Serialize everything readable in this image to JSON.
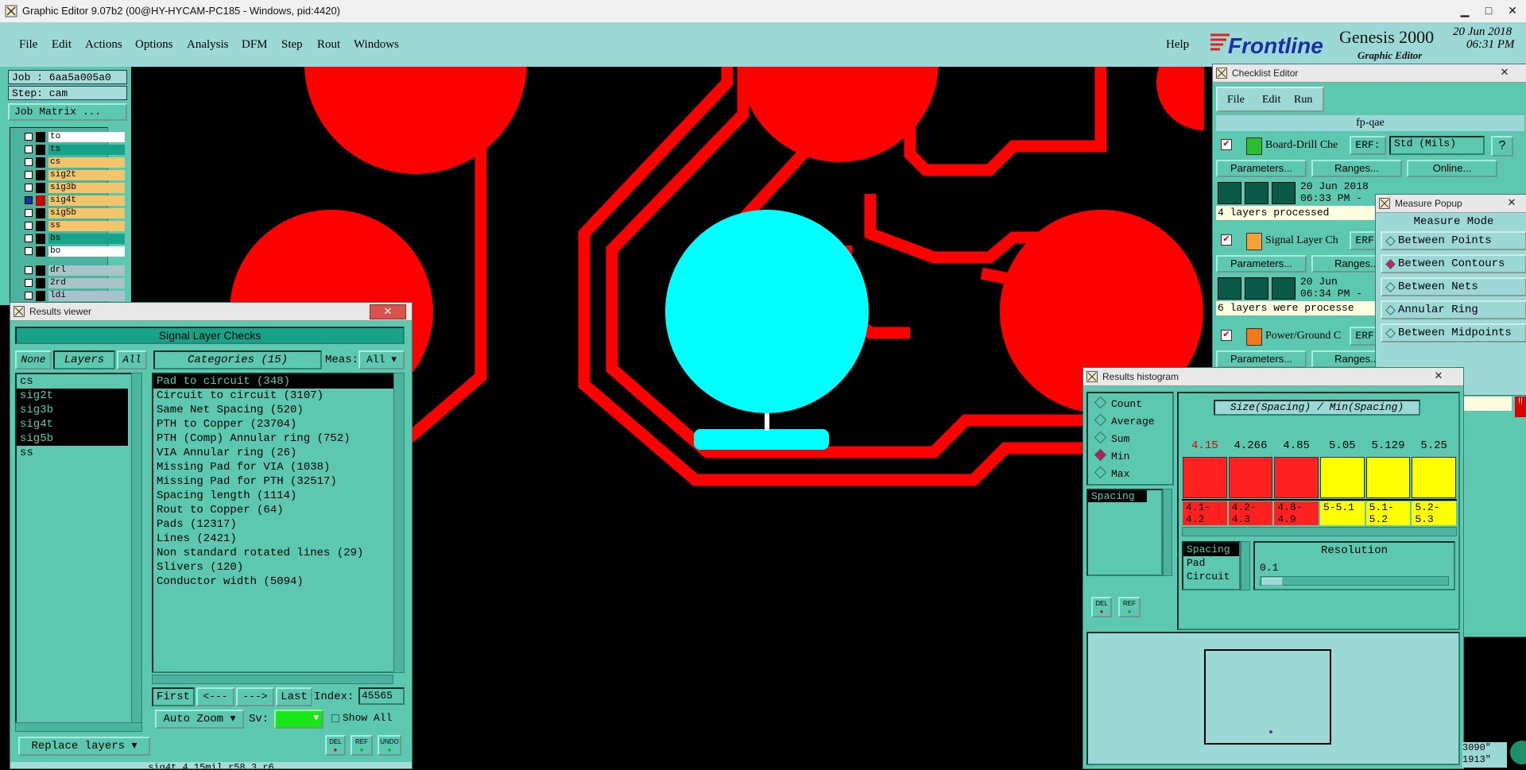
{
  "window": {
    "title": "Graphic Editor 9.07b2 (00@HY-HYCAM-PC185 - Windows, pid:4420)",
    "minimize": "▁",
    "maximize": "□",
    "close": "✕"
  },
  "menubar": {
    "items": [
      "File",
      "Edit",
      "Actions",
      "Options",
      "Analysis",
      "DFM",
      "Step",
      "Rout",
      "Windows"
    ],
    "help": "Help"
  },
  "brand": {
    "logo": "Frontline",
    "product": "Genesis 2000",
    "subtitle": "Graphic Editor",
    "date": "20 Jun 2018",
    "time": "06:31 PM"
  },
  "job": {
    "job_label": "Job : 6aa5a005a0",
    "step_label": "Step: cam",
    "matrix_button": "Job Matrix ..."
  },
  "layers": [
    {
      "name": "to",
      "color": "#ffffff"
    },
    {
      "name": "ts",
      "color": "#17a389"
    },
    {
      "name": "cs",
      "color": "#f4c46a"
    },
    {
      "name": "sig2t",
      "color": "#f4c46a"
    },
    {
      "name": "sig3b",
      "color": "#f4c46a"
    },
    {
      "name": "sig4t",
      "color": "#f4c46a",
      "active": true
    },
    {
      "name": "sig5b",
      "color": "#f4c46a"
    },
    {
      "name": "ss",
      "color": "#f4c46a"
    },
    {
      "name": "bs",
      "color": "#17a389"
    },
    {
      "name": "bo",
      "color": "#ffffff"
    },
    {
      "name": "drl",
      "color": "#a8c4c8"
    },
    {
      "name": "2rd",
      "color": "#a8c4c8"
    },
    {
      "name": "ldi",
      "color": "#a8c4c8"
    }
  ],
  "results_viewer": {
    "title": "Results viewer",
    "close": "✕",
    "header": "Signal Layer Checks",
    "none_btn": "None",
    "layers_btn": "Layers",
    "all_btn": "All",
    "categories_btn": "Categories (15)",
    "meas_label": "Meas:",
    "meas_value": "All",
    "layer_list": [
      "cs",
      "sig2t",
      "sig3b",
      "sig4t",
      "sig5b",
      "ss"
    ],
    "categories": [
      "Pad to circuit (348)",
      "Circuit to circuit (3107)",
      "Same Net Spacing (520)",
      "PTH to Copper (23704)",
      "PTH (Comp) Annular ring (752)",
      "VIA Annular ring (26)",
      "Missing Pad for VIA (1038)",
      "Missing Pad for PTH (32517)",
      "Spacing length (1114)",
      "Rout to Copper (64)",
      "Pads (12317)",
      "Lines (2421)",
      "Non standard rotated lines (29)",
      "Slivers (120)",
      "Conductor width (5094)"
    ],
    "nav": {
      "first": "First",
      "prev": "<---",
      "next": "--->",
      "last": "Last",
      "index_label": "Index:",
      "index_value": "45565"
    },
    "auto_zoom": "Auto Zoom",
    "sv_label": "Sv:",
    "show_all": "Show All",
    "replace_layers": "Replace layers",
    "del": "DEL",
    "ref": "REF",
    "undo": "UNDO",
    "status": "sig4t 4.15mil r58.3 r6"
  },
  "checklist": {
    "title": "Checklist Editor",
    "close": "✕",
    "menu": [
      "File",
      "Edit",
      "Run"
    ],
    "name": "fp-qae",
    "units": "Std (Mils)",
    "help": "?",
    "erf": "ERF:",
    "items": [
      {
        "name": "Board-Drill Che",
        "date": "20 Jun 2018",
        "time": "06:33 PM -",
        "status": "4 layers processed"
      },
      {
        "name": "Signal Layer Ch",
        "date": "20 Jun",
        "time": "06:34 PM -",
        "status": "6 layers were processe"
      },
      {
        "name": "Power/Ground C",
        "date": "",
        "time": "",
        "status": ""
      }
    ],
    "parameters": "Parameters...",
    "ranges": "Ranges...",
    "online": "Online..."
  },
  "measure": {
    "title": "Measure Popup",
    "close": "✕",
    "mode_header": "Measure Mode",
    "modes": [
      "Between Points",
      "Between Contours",
      "Between Nets",
      "Annular Ring",
      "Between Midpoints"
    ],
    "selected": 1
  },
  "histogram": {
    "title": "Results histogram",
    "close": "✕",
    "stats": [
      "Count",
      "Average",
      "Sum",
      "Min",
      "Max"
    ],
    "stat_selected": 3,
    "list_item": "Spacing",
    "chart_title": "Size(Spacing) / Min(Spacing)",
    "sublist": [
      "Spacing",
      "Pad",
      "Circuit"
    ],
    "resolution_label": "Resolution",
    "resolution_value": "0.1",
    "del": "DEL",
    "ref": "REF"
  },
  "chart_data": {
    "type": "bar",
    "title": "Size(Spacing) / Min(Spacing)",
    "categories": [
      "4.1-4.2",
      "4.2-4.3",
      "4.8-4.9",
      "5-5.1",
      "5.1-5.2",
      "5.2-5.3"
    ],
    "value_labels": [
      "4.15",
      "4.266",
      "4.85",
      "5.05",
      "5.129",
      "5.25"
    ],
    "colors": [
      "#ff2020",
      "#ff2020",
      "#ff2020",
      "#ffff00",
      "#ffff00",
      "#ffff00"
    ]
  },
  "coords": {
    "x": "3090\"",
    "y": "1913\""
  }
}
